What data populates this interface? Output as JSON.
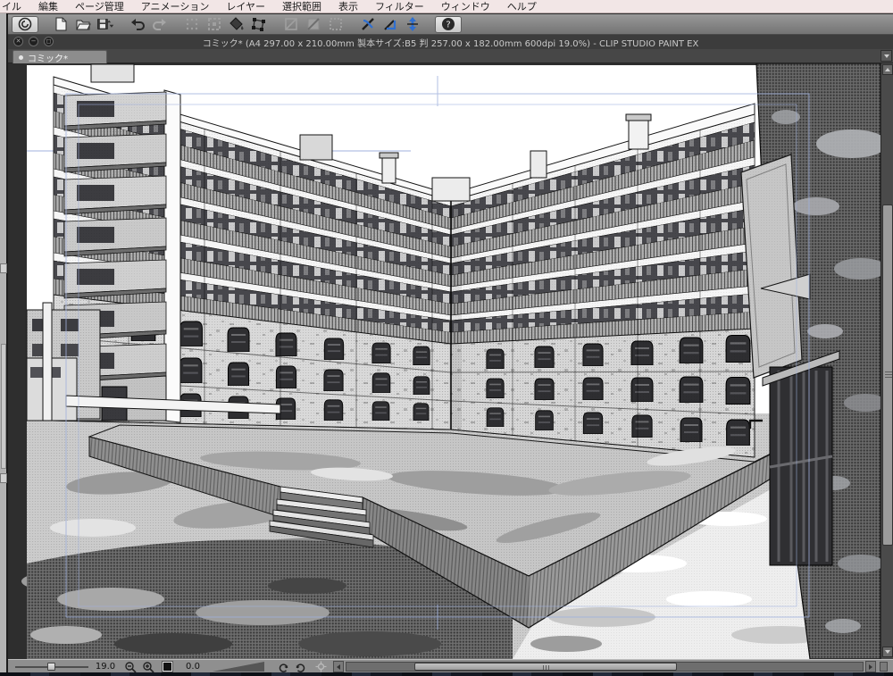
{
  "menubar": {
    "items": [
      "イル",
      "編集",
      "ページ管理",
      "アニメーション",
      "レイヤー",
      "選択範囲",
      "表示",
      "フィルター",
      "ウィンドウ",
      "ヘルプ"
    ]
  },
  "command_bar": {
    "button_names": [
      "clip-studio-logo",
      "new-canvas",
      "open-file",
      "save",
      "undo",
      "redo",
      "erase",
      "erase-outside-selection",
      "fill",
      "transform",
      "layer-mask",
      "layer-clip",
      "layer-lock",
      "snap-ruler",
      "snap-special-ruler",
      "snap-grid",
      "help"
    ]
  },
  "window": {
    "title": "コミック* (A4 297.00 x 210.00mm 製本サイズ:B5 判 257.00 x 182.00mm 600dpi 19.0%)  - CLIP STUDIO PAINT EX",
    "controls": [
      "✕",
      "−",
      "◻"
    ]
  },
  "tabs": {
    "active_label": "コミック*"
  },
  "status_bar": {
    "zoom_value": "19.0",
    "rotation_value": "0.0"
  },
  "colors": {
    "menubar_bg": "#f2e6e6",
    "chrome_dark": "#3c3c3c",
    "toolbar_bg": "#8a8a8a",
    "tab_active_bg": "#8d8d8d",
    "canvas_surround": "#2e2e2e",
    "guide_blue": "#9fb0dd",
    "snap_blue": "#2f6fd0"
  }
}
